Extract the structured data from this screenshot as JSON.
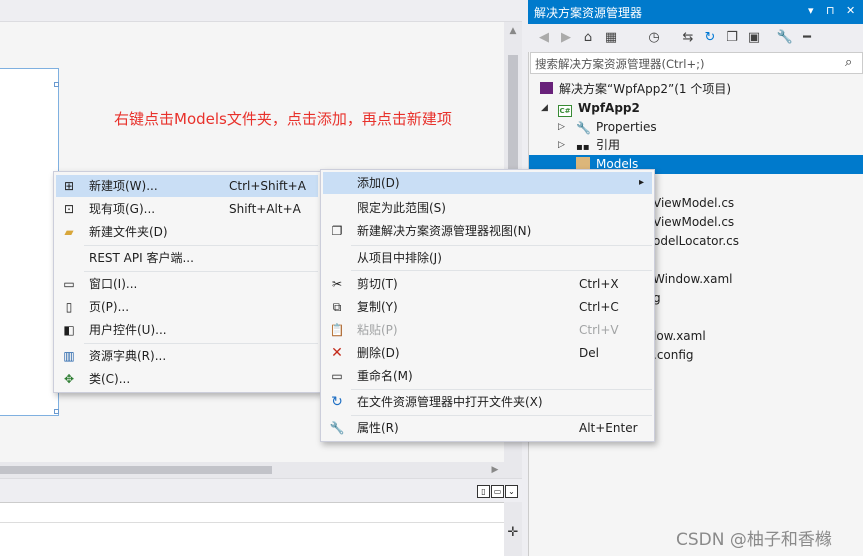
{
  "annotation": "右键点击Models文件夹，点击添加，再点击新建项",
  "solution_explorer": {
    "title": "解决方案资源管理器",
    "title_glyphs": [
      "▾",
      "⊓",
      "✕"
    ],
    "toolbar_icons": [
      "back-icon",
      "forward-icon",
      "home-icon",
      "switch-views-icon",
      "history-icon",
      "sync-icon",
      "refresh-icon",
      "collapse-icon",
      "show-all-icon",
      "properties-icon",
      "pin-icon"
    ],
    "search_placeholder": "搜索解决方案资源管理器(Ctrl+;)",
    "tree": [
      {
        "label": "解决方案“WpfApp2”(1 个项目)"
      },
      {
        "label": "WpfApp2"
      },
      {
        "label": "Properties"
      },
      {
        "label": "引用"
      },
      {
        "label": "Models"
      },
      {
        "label": "el"
      },
      {
        "label": "ViewModel.cs"
      },
      {
        "label": "ViewModel.cs"
      },
      {
        "label": "odelLocator.cs"
      },
      {
        "label": "Window.xaml"
      },
      {
        "label": "g"
      },
      {
        "label": "low.xaml"
      },
      {
        "label": ".config"
      }
    ]
  },
  "add_submenu": {
    "items": [
      {
        "label": "新建项(W)...",
        "shortcut": "Ctrl+Shift+A",
        "icon": "new-item-icon"
      },
      {
        "label": "现有项(G)...",
        "shortcut": "Shift+Alt+A",
        "icon": "existing-item-icon"
      },
      {
        "label": "新建文件夹(D)",
        "shortcut": "",
        "icon": "new-folder-icon"
      },
      {
        "label": "REST API 客户端...",
        "shortcut": "",
        "icon": ""
      },
      {
        "label": "窗口(I)...",
        "shortcut": "",
        "icon": "window-icon"
      },
      {
        "label": "页(P)...",
        "shortcut": "",
        "icon": "page-icon"
      },
      {
        "label": "用户控件(U)...",
        "shortcut": "",
        "icon": "user-control-icon"
      },
      {
        "label": "资源字典(R)...",
        "shortcut": "",
        "icon": "resource-dictionary-icon"
      },
      {
        "label": "类(C)...",
        "shortcut": "",
        "icon": "class-icon"
      }
    ]
  },
  "context_menu": {
    "items": [
      {
        "label": "添加(D)",
        "shortcut": "",
        "submenu_arrow": "▸"
      },
      {
        "label": "限定为此范围(S)",
        "shortcut": ""
      },
      {
        "label": "新建解决方案资源管理器视图(N)",
        "shortcut": ""
      },
      {
        "label": "从项目中排除(J)",
        "shortcut": ""
      },
      {
        "label": "剪切(T)",
        "shortcut": "Ctrl+X"
      },
      {
        "label": "复制(Y)",
        "shortcut": "Ctrl+C"
      },
      {
        "label": "粘贴(P)",
        "shortcut": "Ctrl+V"
      },
      {
        "label": "删除(D)",
        "shortcut": "Del"
      },
      {
        "label": "重命名(M)",
        "shortcut": ""
      },
      {
        "label": "在文件资源管理器中打开文件夹(X)",
        "shortcut": ""
      },
      {
        "label": "属性(R)",
        "shortcut": "Alt+Enter"
      }
    ]
  },
  "watermark": "CSDN @柚子和香橼",
  "colors": {
    "accent": "#007acc",
    "menu_highlight": "#c9def5",
    "annotation": "#e8312b",
    "delete_icon": "#c42b1c"
  }
}
